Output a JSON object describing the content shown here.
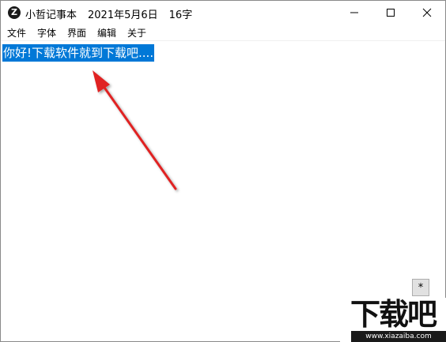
{
  "window": {
    "app_icon_letter": "Z",
    "title": "小哲记事本",
    "date": "2021年5月6日",
    "char_count": "16字",
    "controls": {
      "minimize": "minimize-icon",
      "maximize": "maximize-icon",
      "close": "close-icon"
    }
  },
  "menu": {
    "items": [
      {
        "label": "文件"
      },
      {
        "label": "字体"
      },
      {
        "label": "界面"
      },
      {
        "label": "编辑"
      },
      {
        "label": "关于"
      }
    ]
  },
  "editor": {
    "content": "你好!下载软件就到下载吧....",
    "selection_color": "#0078d7",
    "annotation_arrow_color": "#e02020",
    "star_button_label": "*"
  },
  "watermark": {
    "logo_text": "下载吧",
    "url": "www.xiazaiba.com"
  }
}
